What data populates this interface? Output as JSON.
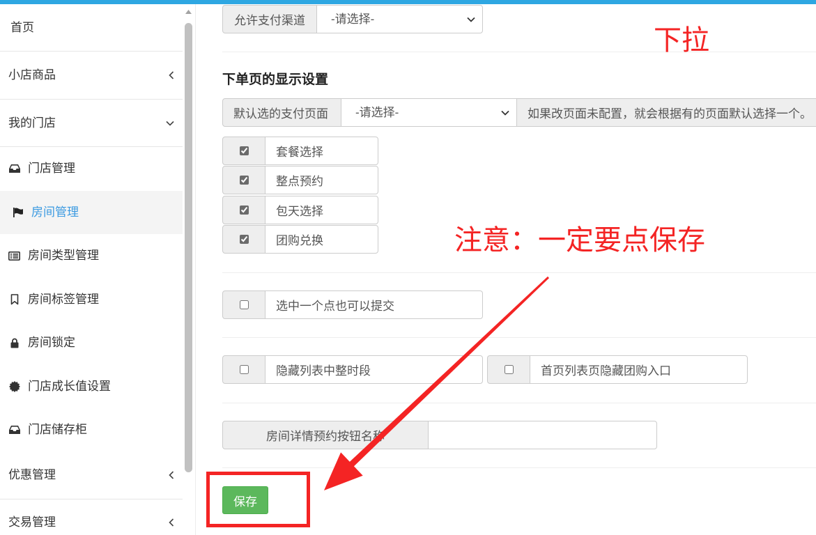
{
  "theme": {
    "topbar_color": "#2ea7e2",
    "active_text_color": "#3b9ae1",
    "active_bg_color": "#f4f4f4",
    "text_color": "#333333",
    "addon_bg_color": "#eeeeee",
    "border_color": "#cccccc",
    "save_button_color": "#5cb85c",
    "scroll_thumb_color": "#c1c1c1"
  },
  "sidebar": {
    "menu": [
      {
        "label": "首页"
      },
      {
        "label": "小店商品",
        "chevron": "chevron-left-icon"
      },
      {
        "label": "我的门店",
        "chevron": "chevron-down-icon",
        "expanded": true,
        "children": [
          {
            "label": "门店管理",
            "icon": "inbox-icon"
          },
          {
            "label": "房间管理",
            "icon": "flag-icon",
            "active": true
          },
          {
            "label": "房间类型管理",
            "icon": "list-alt-icon"
          },
          {
            "label": "房间标签管理",
            "icon": "bookmark-icon"
          },
          {
            "label": "房间锁定",
            "icon": "lock-icon"
          },
          {
            "label": "门店成长值设置",
            "icon": "certificate-icon"
          },
          {
            "label": "门店储存柜",
            "icon": "inbox-icon"
          }
        ]
      },
      {
        "label": "优惠管理",
        "chevron": "chevron-left-icon"
      },
      {
        "label": "交易管理",
        "chevron": "chevron-left-icon"
      }
    ]
  },
  "form": {
    "payment_channel": {
      "label": "允许支付渠道",
      "selected": "-请选择-"
    },
    "order_page_section": {
      "title": "下单页的显示设置",
      "default_pay_page": {
        "label": "默认选的支付页面",
        "selected": "-请选择-",
        "hint": "如果改页面未配置，就会根据有的页面默认选择一个。"
      },
      "options": [
        {
          "label": "套餐选择",
          "checked": true
        },
        {
          "label": "整点预约",
          "checked": true
        },
        {
          "label": "包天选择",
          "checked": true
        },
        {
          "label": "团购兑换",
          "checked": true
        }
      ]
    },
    "single_point_submit": {
      "label": "选中一个点也可以提交",
      "checked": false
    },
    "hide_full_hour_slots": {
      "label": "隐藏列表中整时段",
      "checked": false
    },
    "hide_group_buy_entry": {
      "label": "首页列表页隐藏团购入口",
      "checked": false
    },
    "book_button_name": {
      "label": "房间详情预约按钮名称",
      "value": ""
    },
    "save_label": "保存"
  },
  "annotations": {
    "color": "#f42424",
    "dropdown_note": "下拉",
    "save_note": "注意：一定要点保存"
  }
}
